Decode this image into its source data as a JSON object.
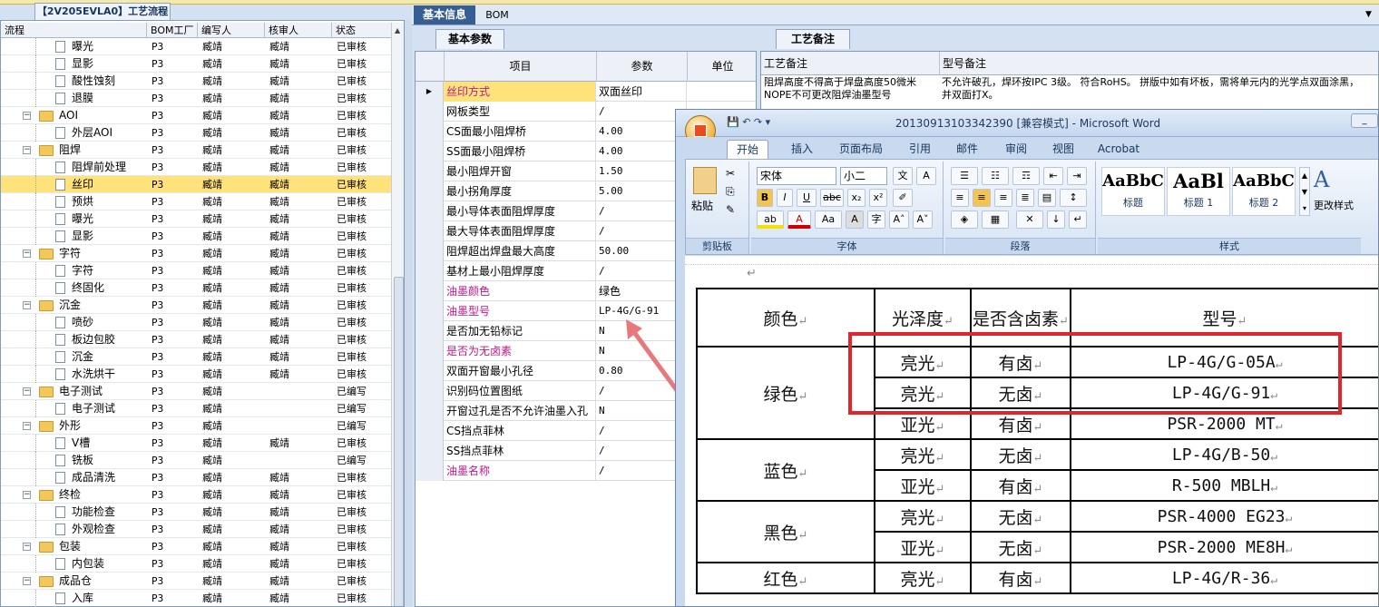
{
  "left_panel": {
    "title": "【2V205EVLA0】工艺流程",
    "columns": [
      "流程",
      "BOM工厂",
      "编写人",
      "核审人",
      "状态"
    ],
    "rows": [
      {
        "level": 2,
        "type": "doc",
        "name": "曝光",
        "bom": "P3",
        "writer": "臧靖",
        "reviewer": "臧靖",
        "status": "已审核"
      },
      {
        "level": 2,
        "type": "doc",
        "name": "显影",
        "bom": "P3",
        "writer": "臧靖",
        "reviewer": "臧靖",
        "status": "已审核"
      },
      {
        "level": 2,
        "type": "doc",
        "name": "酸性蚀刻",
        "bom": "P3",
        "writer": "臧靖",
        "reviewer": "臧靖",
        "status": "已审核"
      },
      {
        "level": 2,
        "type": "doc",
        "name": "退膜",
        "bom": "P3",
        "writer": "臧靖",
        "reviewer": "臧靖",
        "status": "已审核"
      },
      {
        "level": 1,
        "type": "folder",
        "name": "AOI",
        "bom": "P3",
        "writer": "臧靖",
        "reviewer": "臧靖",
        "status": "已审核"
      },
      {
        "level": 2,
        "type": "doc",
        "name": "外层AOI",
        "bom": "P3",
        "writer": "臧靖",
        "reviewer": "臧靖",
        "status": "已审核"
      },
      {
        "level": 1,
        "type": "folder",
        "name": "阻焊",
        "bom": "P3",
        "writer": "臧靖",
        "reviewer": "臧靖",
        "status": "已审核"
      },
      {
        "level": 2,
        "type": "doc",
        "name": "阻焊前处理",
        "bom": "P3",
        "writer": "臧靖",
        "reviewer": "臧靖",
        "status": "已审核"
      },
      {
        "level": 2,
        "type": "doc",
        "name": "丝印",
        "bom": "P3",
        "writer": "臧靖",
        "reviewer": "臧靖",
        "status": "已审核",
        "selected": true
      },
      {
        "level": 2,
        "type": "doc",
        "name": "预烘",
        "bom": "P3",
        "writer": "臧靖",
        "reviewer": "臧靖",
        "status": "已审核"
      },
      {
        "level": 2,
        "type": "doc",
        "name": "曝光",
        "bom": "P3",
        "writer": "臧靖",
        "reviewer": "臧靖",
        "status": "已审核"
      },
      {
        "level": 2,
        "type": "doc",
        "name": "显影",
        "bom": "P3",
        "writer": "臧靖",
        "reviewer": "臧靖",
        "status": "已审核"
      },
      {
        "level": 1,
        "type": "folder",
        "name": "字符",
        "bom": "P3",
        "writer": "臧靖",
        "reviewer": "臧靖",
        "status": "已审核"
      },
      {
        "level": 2,
        "type": "doc",
        "name": "字符",
        "bom": "P3",
        "writer": "臧靖",
        "reviewer": "臧靖",
        "status": "已审核"
      },
      {
        "level": 2,
        "type": "doc",
        "name": "终固化",
        "bom": "P3",
        "writer": "臧靖",
        "reviewer": "臧靖",
        "status": "已审核"
      },
      {
        "level": 1,
        "type": "folder",
        "name": "沉金",
        "bom": "P3",
        "writer": "臧靖",
        "reviewer": "臧靖",
        "status": "已审核"
      },
      {
        "level": 2,
        "type": "doc",
        "name": "喷砂",
        "bom": "P3",
        "writer": "臧靖",
        "reviewer": "臧靖",
        "status": "已审核"
      },
      {
        "level": 2,
        "type": "doc",
        "name": "板边包胶",
        "bom": "P3",
        "writer": "臧靖",
        "reviewer": "臧靖",
        "status": "已审核"
      },
      {
        "level": 2,
        "type": "doc",
        "name": "沉金",
        "bom": "P3",
        "writer": "臧靖",
        "reviewer": "臧靖",
        "status": "已审核"
      },
      {
        "level": 2,
        "type": "doc",
        "name": "水洗烘干",
        "bom": "P3",
        "writer": "臧靖",
        "reviewer": "臧靖",
        "status": "已审核"
      },
      {
        "level": 1,
        "type": "folder",
        "name": "电子测试",
        "bom": "P3",
        "writer": "臧靖",
        "reviewer": "",
        "status": "已编写"
      },
      {
        "level": 2,
        "type": "doc",
        "name": "电子测试",
        "bom": "P3",
        "writer": "臧靖",
        "reviewer": "",
        "status": "已编写"
      },
      {
        "level": 1,
        "type": "folder",
        "name": "外形",
        "bom": "P3",
        "writer": "臧靖",
        "reviewer": "",
        "status": "已编写"
      },
      {
        "level": 2,
        "type": "doc",
        "name": "V槽",
        "bom": "P3",
        "writer": "臧靖",
        "reviewer": "臧靖",
        "status": "已审核"
      },
      {
        "level": 2,
        "type": "doc",
        "name": "铣板",
        "bom": "P3",
        "writer": "臧靖",
        "reviewer": "",
        "status": "已编写"
      },
      {
        "level": 2,
        "type": "doc",
        "name": "成品清洗",
        "bom": "P3",
        "writer": "臧靖",
        "reviewer": "臧靖",
        "status": "已审核"
      },
      {
        "level": 1,
        "type": "folder",
        "name": "终检",
        "bom": "P3",
        "writer": "臧靖",
        "reviewer": "臧靖",
        "status": "已审核"
      },
      {
        "level": 2,
        "type": "doc",
        "name": "功能检查",
        "bom": "P3",
        "writer": "臧靖",
        "reviewer": "臧靖",
        "status": "已审核"
      },
      {
        "level": 2,
        "type": "doc",
        "name": "外观检查",
        "bom": "P3",
        "writer": "臧靖",
        "reviewer": "臧靖",
        "status": "已审核"
      },
      {
        "level": 1,
        "type": "folder",
        "name": "包装",
        "bom": "P3",
        "writer": "臧靖",
        "reviewer": "臧靖",
        "status": "已审核"
      },
      {
        "level": 2,
        "type": "doc",
        "name": "内包装",
        "bom": "P3",
        "writer": "臧靖",
        "reviewer": "臧靖",
        "status": "已审核"
      },
      {
        "level": 1,
        "type": "folder",
        "name": "成品仓",
        "bom": "P3",
        "writer": "臧靖",
        "reviewer": "臧靖",
        "status": "已审核"
      },
      {
        "level": 2,
        "type": "doc",
        "name": "入库",
        "bom": "P3",
        "writer": "臧靖",
        "reviewer": "臧靖",
        "status": "已审核"
      },
      {
        "level": 2,
        "type": "doc",
        "name": "外包装",
        "bom": "P3",
        "writer": "臧靖",
        "reviewer": "臧靖",
        "status": "已审核"
      }
    ]
  },
  "main_tabs": {
    "basic": "基本信息",
    "bom": "BOM"
  },
  "param_panel": {
    "tab": "基本参数",
    "columns": [
      "项目",
      "参数",
      "单位"
    ],
    "rows": [
      {
        "name": "丝印方式",
        "value": "双面丝印",
        "hl": true
      },
      {
        "name": "网板类型",
        "value": "/"
      },
      {
        "name": "CS面最小阻焊桥",
        "value": "4.00"
      },
      {
        "name": "SS面最小阻焊桥",
        "value": "4.00"
      },
      {
        "name": "最小阻焊开窗",
        "value": "1.50"
      },
      {
        "name": "最小拐角厚度",
        "value": "5.00"
      },
      {
        "name": "最小导体表面阻焊厚度",
        "value": "/"
      },
      {
        "name": "最大导体表面阻焊厚度",
        "value": "/"
      },
      {
        "name": "阻焊超出焊盘最大高度",
        "value": "50.00"
      },
      {
        "name": "基材上最小阻焊厚度",
        "value": "/"
      },
      {
        "name": "油墨颜色",
        "value": "绿色",
        "hl": true
      },
      {
        "name": "油墨型号",
        "value": "LP-4G/G-91",
        "hl": true
      },
      {
        "name": "是否加无铅标记",
        "value": "N"
      },
      {
        "name": "是否为无卤素",
        "value": "N",
        "hl": true
      },
      {
        "name": "双面开窗最小孔径",
        "value": "0.80"
      },
      {
        "name": "识别码位置图纸",
        "value": "/"
      },
      {
        "name": "开窗过孔是否不允许油墨入孔",
        "value": "N"
      },
      {
        "name": "CS挡点菲林",
        "value": "/"
      },
      {
        "name": "SS挡点菲林",
        "value": "/"
      },
      {
        "name": "油墨名称",
        "value": "/",
        "hl": true
      }
    ]
  },
  "note_panel": {
    "tab": "工艺备注",
    "columns": [
      "工艺备注",
      "型号备注"
    ],
    "process_note": "阻焊高度不得高于焊盘高度50微米  NOPE不可更改阻焊油墨型号",
    "model_note": "不允许破孔，焊环按IPC 3级。  符合RoHS。  拼版中如有坏板，需将单元内的光学点双面涂黑，并双面打X。"
  },
  "word": {
    "title": "20130913103342390 [兼容模式] - Microsoft Word",
    "tabs": [
      "开始",
      "插入",
      "页面布局",
      "引用",
      "邮件",
      "审阅",
      "视图",
      "Acrobat"
    ],
    "font_name": "宋体",
    "font_size": "小二",
    "groups": [
      "剪贴板",
      "字体",
      "段落",
      "样式"
    ],
    "paste_label": "粘贴",
    "styles": [
      {
        "preview": "AaBbC",
        "label": "标题"
      },
      {
        "preview": "AaBl",
        "label": "标题 1"
      },
      {
        "preview": "AaBbC",
        "label": "标题 2"
      }
    ],
    "change_style": "更改样式",
    "table": {
      "headers": [
        "颜色",
        "光泽度",
        "是否含卤素",
        "型号"
      ],
      "groups": [
        {
          "color": "绿色",
          "rows": [
            {
              "gloss": "亮光",
              "halogen": "有卤",
              "model": "LP-4G/G-05A"
            },
            {
              "gloss": "亮光",
              "halogen": "无卤",
              "model": "LP-4G/G-91"
            },
            {
              "gloss": "亚光",
              "halogen": "有卤",
              "model": "PSR-2000 MT"
            }
          ]
        },
        {
          "color": "蓝色",
          "rows": [
            {
              "gloss": "亮光",
              "halogen": "无卤",
              "model": "LP-4G/B-50"
            },
            {
              "gloss": "亚光",
              "halogen": "有卤",
              "model": "R-500 MBLH"
            }
          ]
        },
        {
          "color": "黑色",
          "rows": [
            {
              "gloss": "亮光",
              "halogen": "无卤",
              "model": "PSR-4000 EG23"
            },
            {
              "gloss": "亚光",
              "halogen": "无卤",
              "model": "PSR-2000 ME8H"
            }
          ]
        },
        {
          "color": "红色",
          "rows": [
            {
              "gloss": "亮光",
              "halogen": "有卤",
              "model": "LP-4G/R-36"
            }
          ]
        }
      ]
    }
  },
  "colors": {
    "highlight_text": "#c0158c",
    "selected_row": "#ffe27a",
    "annotation_red": "#e0262a",
    "tab_active": "#365e93"
  }
}
